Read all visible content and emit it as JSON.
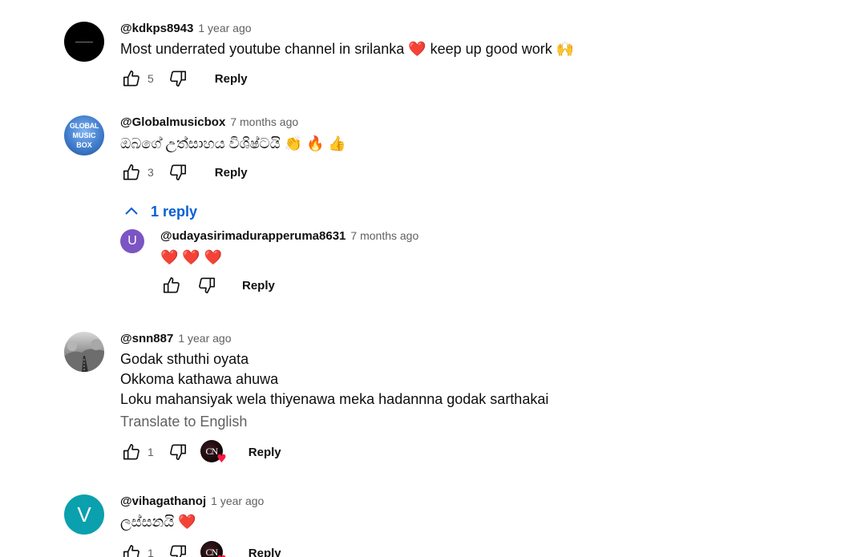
{
  "colors": {
    "link_blue": "#065fd4",
    "muted": "#606060",
    "avatar_u": "#7b55c4",
    "avatar_v": "#0aa0ad"
  },
  "comments": [
    {
      "author": "@kdkps8943",
      "time": "1 year ago",
      "text": "Most underrated youtube channel in srilanka ❤️ keep up good work 🙌",
      "likes": "5",
      "reply_label": "Reply"
    },
    {
      "author": "@Globalmusicbox",
      "avatar_text": [
        "GLOBAL",
        "MUSIC",
        "BOX"
      ],
      "time": "7 months ago",
      "text": "ඔබගේ උත්සාහය විශිෂ්ටයි 👏 🔥 👍",
      "likes": "3",
      "reply_label": "Reply",
      "replies_toggle": "1 reply",
      "replies": [
        {
          "author": "@udayasirimadurapperuma8631",
          "avatar_letter": "U",
          "time": "7 months ago",
          "text": "❤️ ❤️ ❤️",
          "likes": "",
          "reply_label": "Reply"
        }
      ]
    },
    {
      "author": "@snn887",
      "time": "1 year ago",
      "lines": [
        "Godak sthuthi oyata",
        "Okkoma kathawa ahuwa",
        "Loku mahansiyak wela thiyenawa meka hadannna godak sarthakai"
      ],
      "translate_label": "Translate to English",
      "likes": "1",
      "creator_badge": "CN",
      "reply_label": "Reply"
    },
    {
      "author": "@vihagathanoj",
      "avatar_letter": "V",
      "time": "1 year ago",
      "text": "ලස්සනයි ❤️",
      "likes": "1",
      "creator_badge": "CN",
      "reply_label": "Reply"
    }
  ]
}
